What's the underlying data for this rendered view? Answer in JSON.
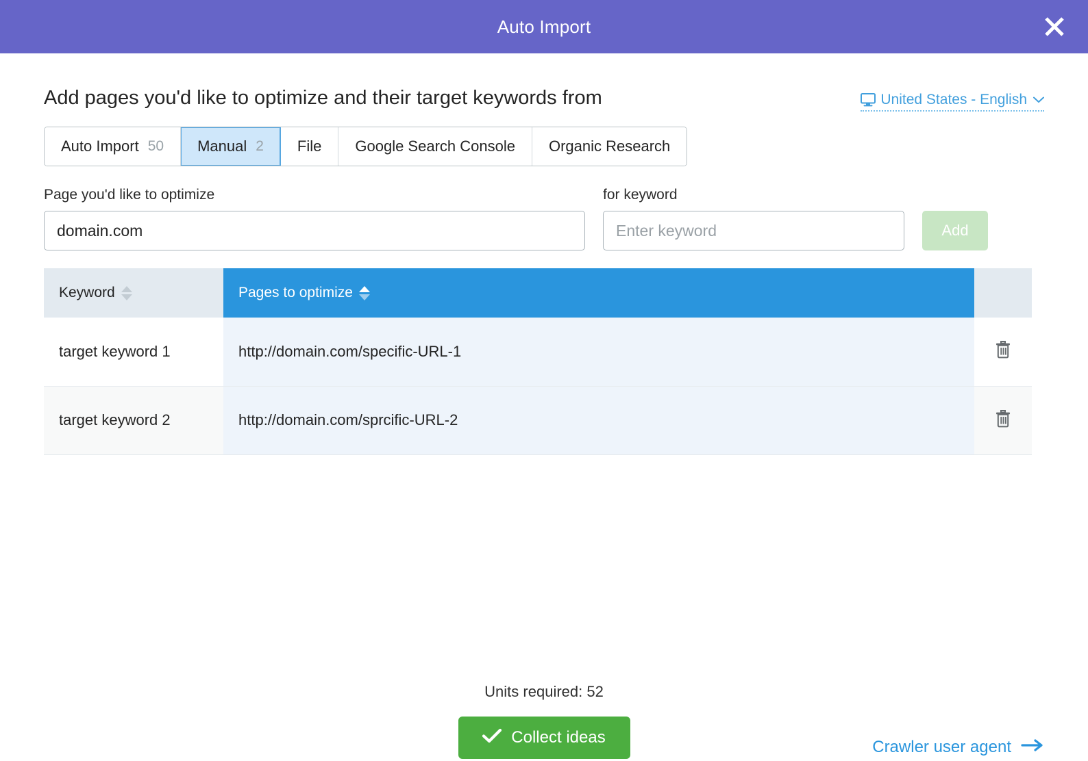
{
  "header": {
    "title": "Auto Import",
    "close_icon": "close-icon",
    "bg_color": "#6665c8"
  },
  "content": {
    "heading": "Add pages you'd like to optimize and their target keywords from",
    "locale": {
      "icon": "monitor-icon",
      "label": "United States - English",
      "chevron": "⌄",
      "color": "#419fdd"
    },
    "tabs": [
      {
        "label": "Auto Import",
        "count": "50",
        "active": false
      },
      {
        "label": "Manual",
        "count": "2",
        "active": true
      },
      {
        "label": "File",
        "count": "",
        "active": false
      },
      {
        "label": "Google Search Console",
        "count": "",
        "active": false
      },
      {
        "label": "Organic Research",
        "count": "",
        "active": false
      }
    ],
    "form": {
      "page_label": "Page you'd like to optimize",
      "page_value": "domain.com",
      "keyword_label": "for keyword",
      "keyword_value": "",
      "keyword_placeholder": "Enter keyword",
      "add_label": "Add"
    },
    "table": {
      "columns": [
        {
          "label": "Keyword",
          "sorted": false,
          "highlight": false
        },
        {
          "label": "Pages to optimize",
          "sorted": true,
          "highlight": true,
          "highlight_color": "#2a95dd"
        },
        {
          "label": "",
          "sorted": false,
          "highlight": false
        }
      ],
      "rows": [
        {
          "keyword": "target keyword 1",
          "page": "http://domain.com/specific-URL-1",
          "delete_icon": "trash-icon"
        },
        {
          "keyword": "target keyword 2",
          "page": "http://domain.com/sprcific-URL-2",
          "delete_icon": "trash-icon"
        }
      ]
    }
  },
  "footer": {
    "units_text": "Units required: 52",
    "collect_label": "Collect ideas",
    "collect_icon": "check-icon",
    "collect_color": "#4cae40",
    "crawler_label": "Crawler user agent",
    "crawler_icon": "arrow-right-icon",
    "crawler_color": "#2a95dd"
  }
}
